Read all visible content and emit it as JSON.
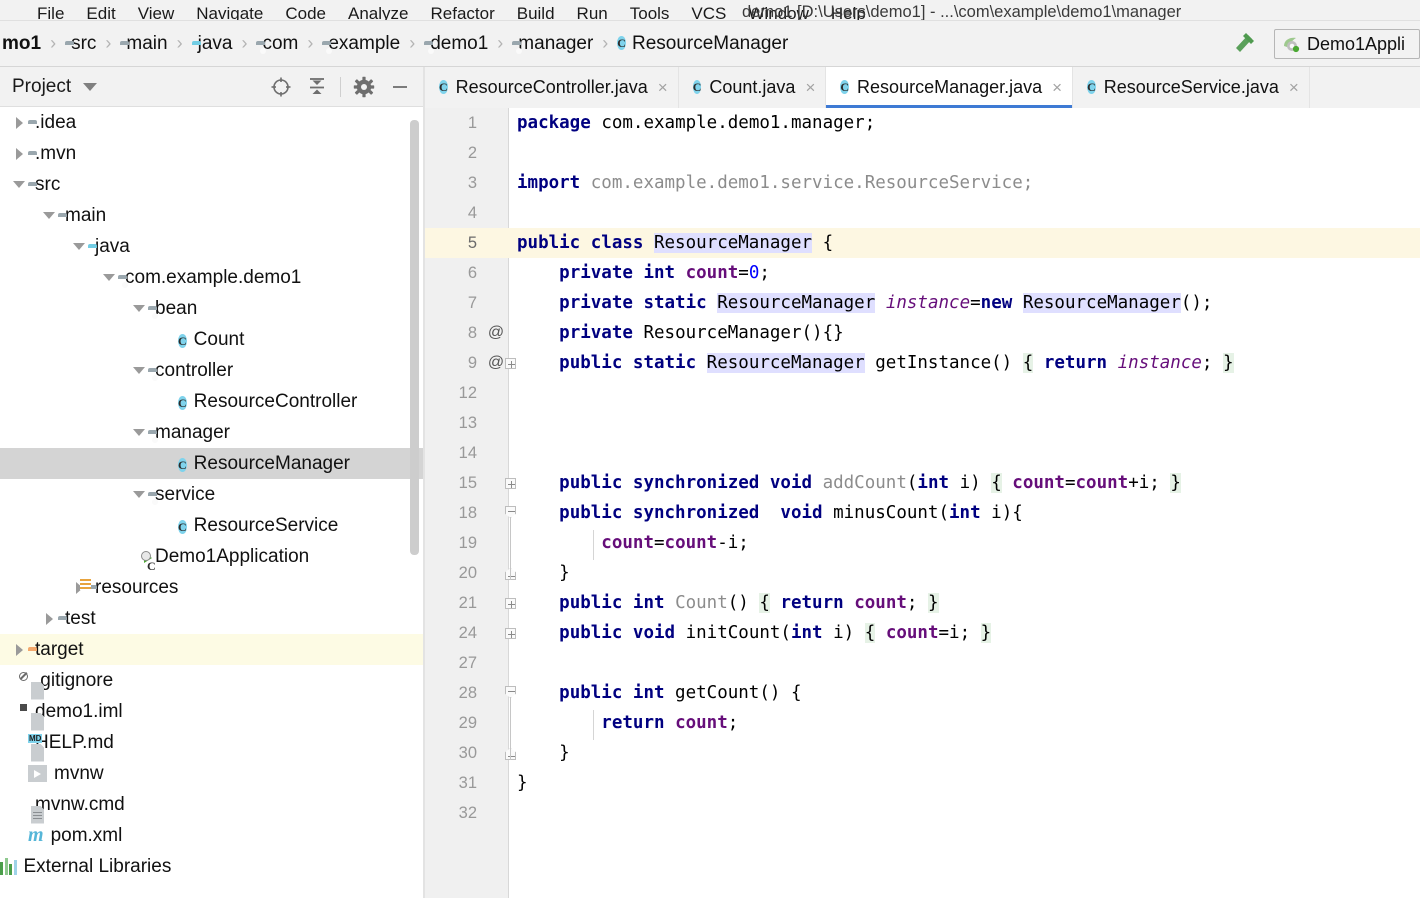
{
  "window": {
    "title": "demo1 [D:\\Users\\demo1] - ...\\com\\example\\demo1\\manager"
  },
  "menu": {
    "items": [
      "File",
      "Edit",
      "View",
      "Navigate",
      "Code",
      "Analyze",
      "Refactor",
      "Build",
      "Run",
      "Tools",
      "VCS",
      "Window",
      "Help"
    ]
  },
  "breadcrumb": {
    "items": [
      {
        "label": "mo1",
        "icon": "none"
      },
      {
        "label": "src",
        "icon": "folder-icon"
      },
      {
        "label": "main",
        "icon": "folder-icon"
      },
      {
        "label": "java",
        "icon": "folder-source-icon"
      },
      {
        "label": "com",
        "icon": "package-icon"
      },
      {
        "label": "example",
        "icon": "package-icon"
      },
      {
        "label": "demo1",
        "icon": "package-icon"
      },
      {
        "label": "manager",
        "icon": "package-icon"
      },
      {
        "label": "ResourceManager",
        "icon": "class-icon"
      }
    ]
  },
  "toolbar": {
    "build_icon": "hammer-icon",
    "run_config_label": "Demo1Appli",
    "run_config_icon": "spring-boot-icon"
  },
  "project_panel": {
    "title": "Project",
    "actions": [
      {
        "name": "select-opened-file-icon",
        "label": "locate"
      },
      {
        "name": "collapse-all-icon",
        "label": "collapse all"
      },
      {
        "name": "gear-icon",
        "label": "settings"
      },
      {
        "name": "hide-icon",
        "label": "hide"
      }
    ],
    "tree": [
      {
        "label": ".idea",
        "indent": 0,
        "twisty": "right",
        "icon": "folder-icon",
        "state": "normal"
      },
      {
        "label": ".mvn",
        "indent": 0,
        "twisty": "right",
        "icon": "folder-icon",
        "state": "normal"
      },
      {
        "label": "src",
        "indent": 0,
        "twisty": "down",
        "icon": "folder-icon",
        "state": "normal"
      },
      {
        "label": "main",
        "indent": 1,
        "twisty": "down",
        "icon": "folder-icon",
        "state": "normal"
      },
      {
        "label": "java",
        "indent": 2,
        "twisty": "down",
        "icon": "folder-source-icon",
        "state": "normal"
      },
      {
        "label": "com.example.demo1",
        "indent": 3,
        "twisty": "down",
        "icon": "package-icon",
        "state": "normal"
      },
      {
        "label": "bean",
        "indent": 4,
        "twisty": "down",
        "icon": "package-icon",
        "state": "normal"
      },
      {
        "label": "Count",
        "indent": 5,
        "twisty": "none",
        "icon": "class-icon",
        "state": "normal"
      },
      {
        "label": "controller",
        "indent": 4,
        "twisty": "down",
        "icon": "package-icon",
        "state": "normal"
      },
      {
        "label": "ResourceController",
        "indent": 5,
        "twisty": "none",
        "icon": "class-icon",
        "state": "normal"
      },
      {
        "label": "manager",
        "indent": 4,
        "twisty": "down",
        "icon": "package-icon",
        "state": "normal"
      },
      {
        "label": "ResourceManager",
        "indent": 5,
        "twisty": "none",
        "icon": "class-icon",
        "state": "selected"
      },
      {
        "label": "service",
        "indent": 4,
        "twisty": "down",
        "icon": "package-icon",
        "state": "normal"
      },
      {
        "label": "ResourceService",
        "indent": 5,
        "twisty": "none",
        "icon": "class-icon",
        "state": "normal"
      },
      {
        "label": "Demo1Application",
        "indent": 4,
        "twisty": "none",
        "icon": "runnable-class-icon",
        "state": "normal"
      },
      {
        "label": "resources",
        "indent": 2,
        "twisty": "right",
        "icon": "resources-folder-icon",
        "state": "normal"
      },
      {
        "label": "test",
        "indent": 1,
        "twisty": "right",
        "icon": "folder-icon",
        "state": "normal"
      },
      {
        "label": "target",
        "indent": 0,
        "twisty": "right",
        "icon": "folder-excluded-icon",
        "state": "highlight"
      },
      {
        "label": ".gitignore",
        "indent": 0,
        "twisty": "none",
        "icon": "gitignore-file-icon",
        "state": "normal"
      },
      {
        "label": "demo1.iml",
        "indent": 0,
        "twisty": "none",
        "icon": "iml-file-icon",
        "state": "normal"
      },
      {
        "label": "HELP.md",
        "indent": 0,
        "twisty": "none",
        "icon": "markdown-file-icon",
        "state": "normal"
      },
      {
        "label": "mvnw",
        "indent": 0,
        "twisty": "none",
        "icon": "script-file-icon",
        "state": "normal"
      },
      {
        "label": "mvnw.cmd",
        "indent": 0,
        "twisty": "none",
        "icon": "cmd-file-icon",
        "state": "normal"
      },
      {
        "label": "pom.xml",
        "indent": 0,
        "twisty": "none",
        "icon": "maven-file-icon",
        "state": "normal"
      },
      {
        "label": "External Libraries",
        "indent": -1,
        "twisty": "none",
        "icon": "libraries-icon",
        "state": "normal"
      }
    ]
  },
  "editor_tabs": [
    {
      "label": "ResourceController.java",
      "active": false,
      "icon": "class-icon",
      "close": "×"
    },
    {
      "label": "Count.java",
      "active": false,
      "icon": "class-icon",
      "close": "×"
    },
    {
      "label": "ResourceManager.java",
      "active": true,
      "icon": "class-icon",
      "close": "×"
    },
    {
      "label": "ResourceService.java",
      "active": false,
      "icon": "class-icon",
      "close": "×"
    }
  ],
  "editor": {
    "current_line": 5,
    "lines": [
      {
        "num": "1",
        "at": "",
        "fold": "none",
        "current": false,
        "tokens": [
          {
            "t": "package",
            "c": "kw"
          },
          {
            "t": " ",
            "c": "plain"
          },
          {
            "t": "com.example.demo1.manager;",
            "c": "plain"
          }
        ]
      },
      {
        "num": "2",
        "at": "",
        "fold": "none",
        "current": false,
        "tokens": []
      },
      {
        "num": "3",
        "at": "",
        "fold": "none",
        "current": false,
        "tokens": [
          {
            "t": "import",
            "c": "kw"
          },
          {
            "t": " ",
            "c": "plain"
          },
          {
            "t": "com.example.demo1.service.ResourceService;",
            "c": "gray"
          }
        ]
      },
      {
        "num": "4",
        "at": "",
        "fold": "none",
        "current": false,
        "tokens": []
      },
      {
        "num": "5",
        "at": "",
        "fold": "none",
        "current": true,
        "tokens": [
          {
            "t": "public class",
            "c": "kw"
          },
          {
            "t": " ",
            "c": "plain"
          },
          {
            "t": "ResourceManager",
            "c": "plain id-hl"
          },
          {
            "t": " {",
            "c": "plain"
          }
        ]
      },
      {
        "num": "6",
        "at": "",
        "fold": "none",
        "current": false,
        "tokens": [
          {
            "t": "    ",
            "c": "plain"
          },
          {
            "t": "private int",
            "c": "kw"
          },
          {
            "t": " ",
            "c": "plain"
          },
          {
            "t": "count",
            "c": "fld"
          },
          {
            "t": "=",
            "c": "plain"
          },
          {
            "t": "0",
            "c": "num2"
          },
          {
            "t": ";",
            "c": "plain"
          }
        ]
      },
      {
        "num": "7",
        "at": "",
        "fold": "none",
        "current": false,
        "tokens": [
          {
            "t": "    ",
            "c": "plain"
          },
          {
            "t": "private static",
            "c": "kw"
          },
          {
            "t": " ",
            "c": "plain"
          },
          {
            "t": "ResourceManager",
            "c": "plain id-hl"
          },
          {
            "t": " ",
            "c": "plain"
          },
          {
            "t": "instance",
            "c": "itl"
          },
          {
            "t": "=",
            "c": "plain"
          },
          {
            "t": "new",
            "c": "kw"
          },
          {
            "t": " ",
            "c": "plain"
          },
          {
            "t": "ResourceManager",
            "c": "plain id-hl"
          },
          {
            "t": "();",
            "c": "plain"
          }
        ]
      },
      {
        "num": "8",
        "at": "@",
        "fold": "none",
        "current": false,
        "tokens": [
          {
            "t": "    ",
            "c": "plain"
          },
          {
            "t": "private",
            "c": "kw"
          },
          {
            "t": " ResourceManager(){}",
            "c": "plain"
          }
        ]
      },
      {
        "num": "9",
        "at": "@",
        "fold": "plus",
        "current": false,
        "tokens": [
          {
            "t": "    ",
            "c": "plain"
          },
          {
            "t": "public static",
            "c": "kw"
          },
          {
            "t": " ",
            "c": "plain"
          },
          {
            "t": "ResourceManager",
            "c": "plain id-hl"
          },
          {
            "t": " getInstance() ",
            "c": "plain"
          },
          {
            "t": "{",
            "c": "plain br-hl"
          },
          {
            "t": " ",
            "c": "plain"
          },
          {
            "t": "return",
            "c": "kw"
          },
          {
            "t": " ",
            "c": "plain"
          },
          {
            "t": "instance",
            "c": "itl"
          },
          {
            "t": ";",
            "c": "plain"
          },
          {
            "t": " ",
            "c": "plain"
          },
          {
            "t": "}",
            "c": "plain br-hl"
          }
        ]
      },
      {
        "num": "12",
        "at": "",
        "fold": "none",
        "current": false,
        "tokens": []
      },
      {
        "num": "13",
        "at": "",
        "fold": "none",
        "current": false,
        "tokens": []
      },
      {
        "num": "14",
        "at": "",
        "fold": "none",
        "current": false,
        "tokens": []
      },
      {
        "num": "15",
        "at": "",
        "fold": "plus",
        "current": false,
        "tokens": [
          {
            "t": "    ",
            "c": "plain"
          },
          {
            "t": "public synchronized void",
            "c": "kw"
          },
          {
            "t": " ",
            "c": "plain"
          },
          {
            "t": "addCount",
            "c": "gray"
          },
          {
            "t": "(",
            "c": "plain"
          },
          {
            "t": "int",
            "c": "kw"
          },
          {
            "t": " i) ",
            "c": "plain"
          },
          {
            "t": "{",
            "c": "plain br-hl"
          },
          {
            "t": " ",
            "c": "plain"
          },
          {
            "t": "count",
            "c": "fld"
          },
          {
            "t": "=",
            "c": "plain"
          },
          {
            "t": "count",
            "c": "fld"
          },
          {
            "t": "+i; ",
            "c": "plain"
          },
          {
            "t": "}",
            "c": "plain br-hl"
          }
        ]
      },
      {
        "num": "18",
        "at": "",
        "fold": "open",
        "current": false,
        "tokens": [
          {
            "t": "    ",
            "c": "plain"
          },
          {
            "t": "public synchronized",
            "c": "kw"
          },
          {
            "t": "  ",
            "c": "plain"
          },
          {
            "t": "void",
            "c": "kw"
          },
          {
            "t": " minusCount(",
            "c": "plain"
          },
          {
            "t": "int",
            "c": "kw"
          },
          {
            "t": " i){",
            "c": "plain"
          }
        ]
      },
      {
        "num": "19",
        "at": "",
        "fold": "bar",
        "current": false,
        "tokens": [
          {
            "t": "        ",
            "c": "plain"
          },
          {
            "t": "count",
            "c": "fld"
          },
          {
            "t": "=",
            "c": "plain"
          },
          {
            "t": "count",
            "c": "fld"
          },
          {
            "t": "-i;",
            "c": "plain"
          }
        ]
      },
      {
        "num": "20",
        "at": "",
        "fold": "end",
        "current": false,
        "tokens": [
          {
            "t": "    }",
            "c": "plain"
          }
        ]
      },
      {
        "num": "21",
        "at": "",
        "fold": "plus",
        "current": false,
        "tokens": [
          {
            "t": "    ",
            "c": "plain"
          },
          {
            "t": "public int",
            "c": "kw"
          },
          {
            "t": " ",
            "c": "plain"
          },
          {
            "t": "Count",
            "c": "gray"
          },
          {
            "t": "() ",
            "c": "plain"
          },
          {
            "t": "{",
            "c": "plain br-hl"
          },
          {
            "t": " ",
            "c": "plain"
          },
          {
            "t": "return",
            "c": "kw"
          },
          {
            "t": " ",
            "c": "plain"
          },
          {
            "t": "count",
            "c": "fld"
          },
          {
            "t": "; ",
            "c": "plain"
          },
          {
            "t": "}",
            "c": "plain br-hl"
          }
        ]
      },
      {
        "num": "24",
        "at": "",
        "fold": "plus",
        "current": false,
        "tokens": [
          {
            "t": "    ",
            "c": "plain"
          },
          {
            "t": "public void",
            "c": "kw"
          },
          {
            "t": " initCount(",
            "c": "plain"
          },
          {
            "t": "int",
            "c": "kw"
          },
          {
            "t": " i) ",
            "c": "plain"
          },
          {
            "t": "{",
            "c": "plain br-hl"
          },
          {
            "t": " ",
            "c": "plain"
          },
          {
            "t": "count",
            "c": "fld"
          },
          {
            "t": "=i; ",
            "c": "plain"
          },
          {
            "t": "}",
            "c": "plain br-hl"
          }
        ]
      },
      {
        "num": "27",
        "at": "",
        "fold": "none",
        "current": false,
        "tokens": []
      },
      {
        "num": "28",
        "at": "",
        "fold": "open",
        "current": false,
        "tokens": [
          {
            "t": "    ",
            "c": "plain"
          },
          {
            "t": "public int",
            "c": "kw"
          },
          {
            "t": " getCount() {",
            "c": "plain"
          }
        ]
      },
      {
        "num": "29",
        "at": "",
        "fold": "bar",
        "current": false,
        "tokens": [
          {
            "t": "        ",
            "c": "plain"
          },
          {
            "t": "return",
            "c": "kw"
          },
          {
            "t": " ",
            "c": "plain"
          },
          {
            "t": "count",
            "c": "fld"
          },
          {
            "t": ";",
            "c": "plain"
          }
        ]
      },
      {
        "num": "30",
        "at": "",
        "fold": "end",
        "current": false,
        "tokens": [
          {
            "t": "    }",
            "c": "plain"
          }
        ]
      },
      {
        "num": "31",
        "at": "",
        "fold": "none",
        "current": false,
        "tokens": [
          {
            "t": "}",
            "c": "plain"
          }
        ]
      },
      {
        "num": "32",
        "at": "",
        "fold": "none",
        "current": false,
        "tokens": []
      }
    ]
  },
  "colors": {
    "keyword": "#000080",
    "field": "#660e7a",
    "grayed": "#8c8c8c",
    "identifier_highlight": "#dfdfff",
    "brace_highlight": "#e6f2e6",
    "current_line": "#fdf7e2",
    "tab_active_underline": "#3e7ad4",
    "selection": "#d4d4d4",
    "excluded_folder": "#f3a86b"
  }
}
